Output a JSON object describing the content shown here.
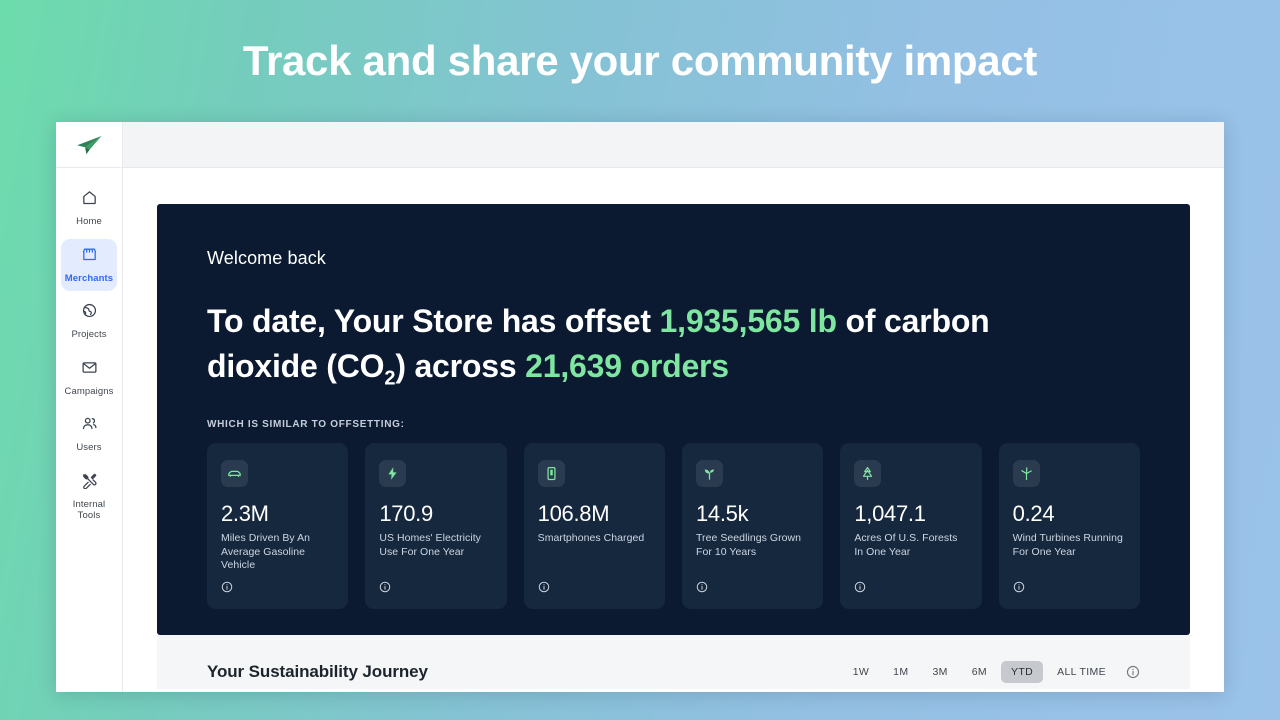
{
  "banner": {
    "title": "Track and share your community impact"
  },
  "sidebar": {
    "logo_icon": "paper-plane-icon",
    "items": [
      {
        "label": "Home",
        "icon": "home-icon",
        "active": false
      },
      {
        "label": "Merchants",
        "icon": "storefront-icon",
        "active": true
      },
      {
        "label": "Projects",
        "icon": "globe-icon",
        "active": false
      },
      {
        "label": "Campaigns",
        "icon": "envelope-icon",
        "active": false
      },
      {
        "label": "Users",
        "icon": "users-icon",
        "active": false
      },
      {
        "label": "Internal Tools",
        "icon": "tools-icon",
        "active": false
      }
    ]
  },
  "hero": {
    "welcome": "Welcome back",
    "headline_part1": "To date, Your Store has offset ",
    "headline_highlight1": "1,935,565 lb",
    "headline_part2": " of carbon dioxide (CO",
    "headline_sub": "2",
    "headline_part3": ") across ",
    "headline_highlight2": "21,639 orders",
    "offset_label": "WHICH IS SIMILAR TO OFFSETTING:",
    "accent_green": "#7ee6a0",
    "panel_bg": "#0b1a30",
    "card_bg": "#16283e"
  },
  "cards": [
    {
      "value": "2.3M",
      "label": "Miles Driven By An Average Gasoline Vehicle",
      "icon": "car-icon"
    },
    {
      "value": "170.9",
      "label": "US Homes' Electricity Use For One Year",
      "icon": "lightning-icon"
    },
    {
      "value": "106.8M",
      "label": "Smartphones Charged",
      "icon": "smartphone-icon"
    },
    {
      "value": "14.5k",
      "label": "Tree Seedlings Grown For 10 Years",
      "icon": "seedling-icon"
    },
    {
      "value": "1,047.1",
      "label": "Acres Of U.S. Forests In One Year",
      "icon": "tree-icon"
    },
    {
      "value": "0.24",
      "label": "Wind Turbines Running For One Year",
      "icon": "wind-turbine-icon"
    }
  ],
  "journey": {
    "title": "Your Sustainability Journey",
    "ranges": [
      {
        "label": "1W",
        "selected": false
      },
      {
        "label": "1M",
        "selected": false
      },
      {
        "label": "3M",
        "selected": false
      },
      {
        "label": "6M",
        "selected": false
      },
      {
        "label": "YTD",
        "selected": true
      },
      {
        "label": "ALL TIME",
        "selected": false
      }
    ],
    "info_icon": "info-icon"
  }
}
